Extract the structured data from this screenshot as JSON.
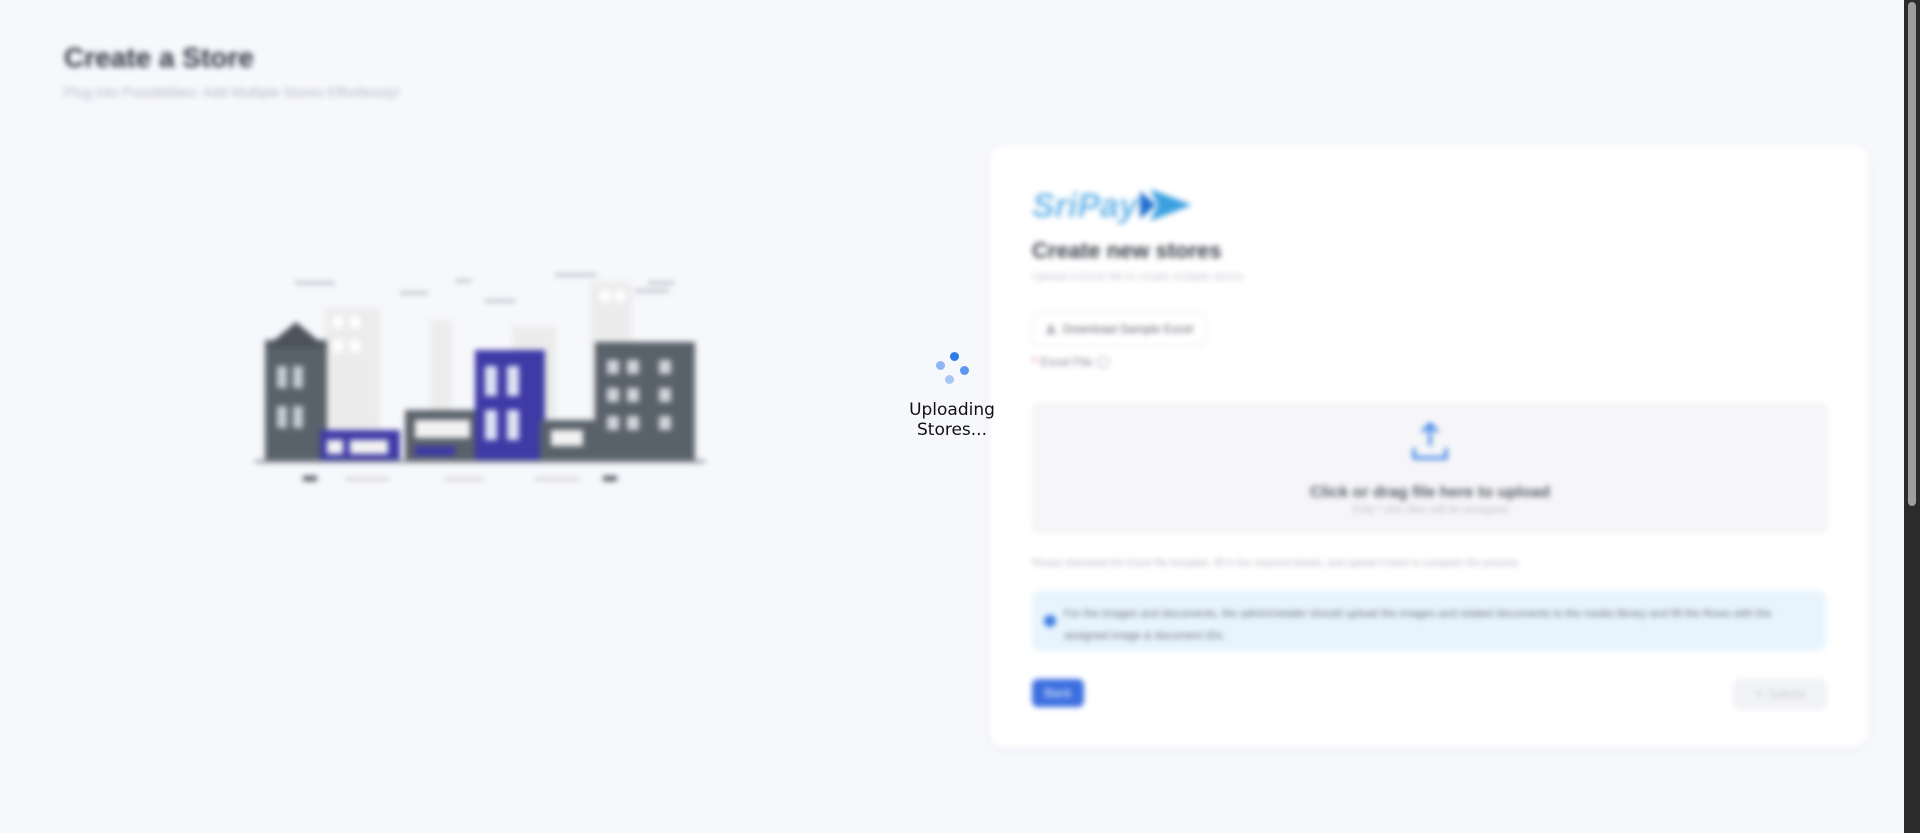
{
  "page": {
    "title": "Create a Store",
    "subtitle": "Plug into Possibilities: Add Multiple Stores Effortlessly!"
  },
  "card": {
    "logo_text": "SriPay",
    "title": "Create new stores",
    "description": "Upload a Excel file to create multiple stores",
    "download_button": "Download Sample Excel",
    "field_label": "Excel File",
    "dropzone": {
      "text": "Click or drag file here to upload",
      "hint": "Only *.xlsx files will be accepted"
    },
    "instructions": "Please download the Excel file template, fill in the required details, and upload it back to complete the process.",
    "alert": "For the images and documents, the admin/retailer should upload the images and related documents to the media library and fill the Rows with the assigned image & document IDs.",
    "back_button": "Back",
    "submit_button": "Submit"
  },
  "overlay": {
    "loading_text": "Uploading Stores..."
  },
  "colors": {
    "accent": "#3b6fe0",
    "spinner": "#2f7be6",
    "background": "#f7f8fc",
    "alert_bg": "#e8f4fd",
    "building_purple": "#3e3aa6",
    "building_gray": "#59616a"
  },
  "icons": {
    "download": "download-icon",
    "help": "question-circle-icon",
    "upload": "upload-icon",
    "info": "info-icon",
    "submit": "upload-icon",
    "spinner": "loading-spinner"
  }
}
